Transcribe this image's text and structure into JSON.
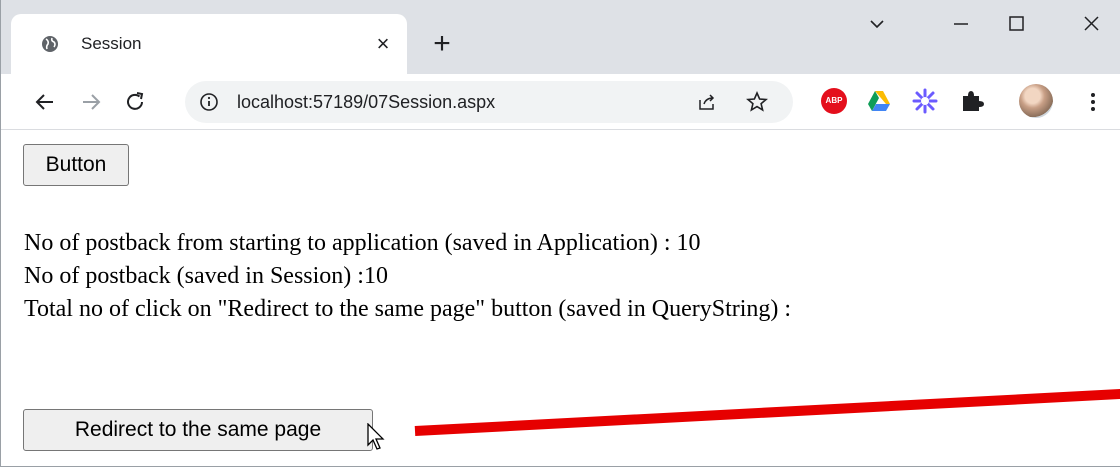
{
  "browser": {
    "tab": {
      "title": "Session",
      "close_glyph": "×"
    },
    "new_tab_glyph": "+",
    "window_controls": [
      "chevron-down-icon",
      "minimize-icon",
      "maximize-icon",
      "close-icon"
    ],
    "url": "localhost:57189/07Session.aspx",
    "extensions": {
      "abp_label": "ABP"
    }
  },
  "page": {
    "button_label": "Button",
    "lines": [
      "No of postback from starting to application  (saved in Application) : 10",
      "No of postback (saved in Session) :10",
      "Total no of click on \"Redirect to the same page\" button (saved in QueryString) :"
    ],
    "redirect_button_label": "Redirect to the same page"
  },
  "colors": {
    "annotation_arrow": "#e60000",
    "tabstrip_bg": "#dee1e6",
    "omnibox_bg": "#f1f3f4",
    "button_bg": "#efefef"
  }
}
